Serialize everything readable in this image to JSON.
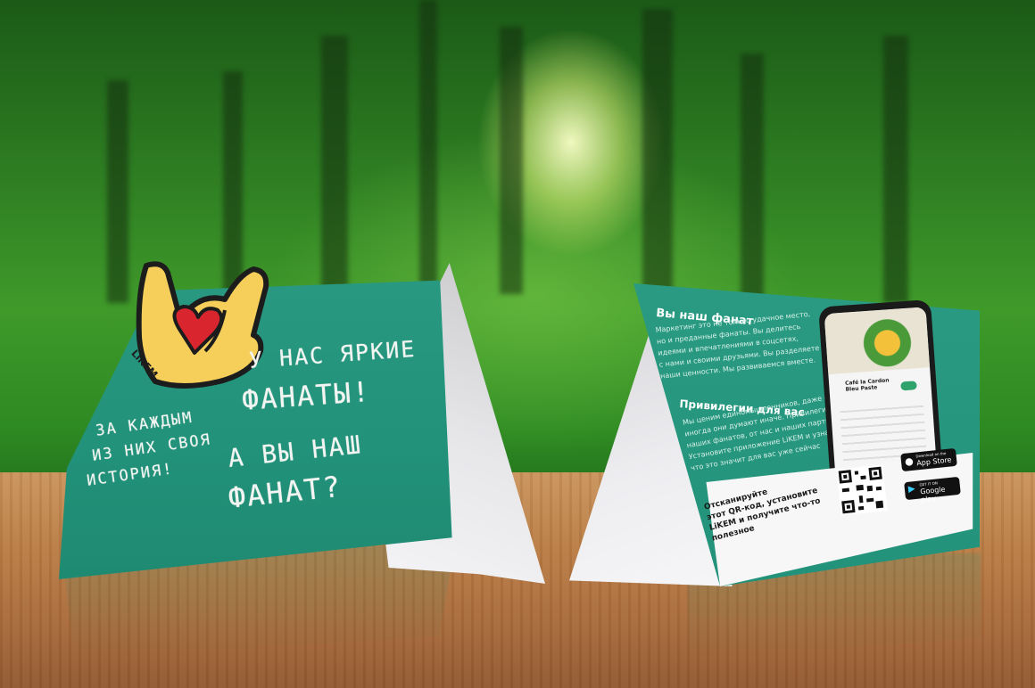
{
  "left_card": {
    "logo_text": "LiKEM",
    "headline_1": "У НАС ЯРКИЕ",
    "headline_2": "ФАНАТЫ!",
    "left_lines": [
      "ЗА КАЖДЫМ",
      "ИЗ НИХ СВОЯ",
      "ИСТОРИЯ!"
    ],
    "question_1": "А ВЫ НАШ",
    "question_2": "ФАНАТ?"
  },
  "right_card": {
    "title": "Вы наш фанат",
    "paragraph_lines": [
      "Маркетинг это не только удачное место,",
      "но и преданные фанаты. Вы делитесь",
      "идеями и впечатлениями в соцсетях,",
      "с нами и своими друзьями. Вы разделяете",
      "наши ценности. Мы развиваемся вместе."
    ],
    "subtitle": "Привилегии для вас",
    "paragraph2_lines": [
      "Мы ценим единомышленников, даже если",
      "иногда они думают иначе. Привилегии для",
      "наших фанатов, от нас и наших партнеров.",
      "Установите приложение LiKEM и узнайте,",
      "что это значит для вас уже сейчас"
    ],
    "qr_cta_lines": [
      "Отсканируйте",
      "этот QR-код, установите",
      "LiKEM и получите что-то",
      "полезное"
    ],
    "app_store_small": "Download on the",
    "app_store": "App Store",
    "google_play_small": "GET IT ON",
    "google_play": "Google play",
    "phone_card_title": "Café la Cardon Bleu Paste"
  },
  "colors": {
    "card_green": "#22927a",
    "heart": "#d9262e",
    "hand": "#f5cf5a"
  }
}
